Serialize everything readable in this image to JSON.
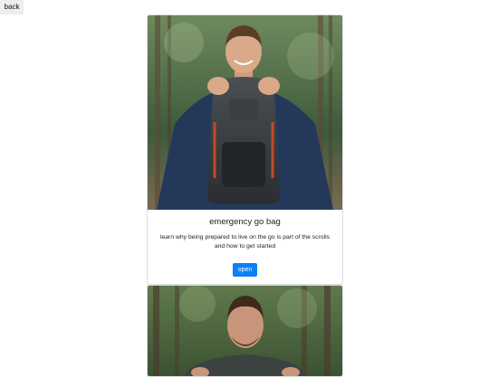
{
  "nav": {
    "back_label": "back"
  },
  "cards": [
    {
      "title": "emergency go bag",
      "description": "learn why being prepared to live on the go is part of the scrolls and how to get started",
      "button_label": "open"
    }
  ],
  "colors": {
    "accent": "#0d7ff5",
    "back_bg": "#eeeeee"
  }
}
